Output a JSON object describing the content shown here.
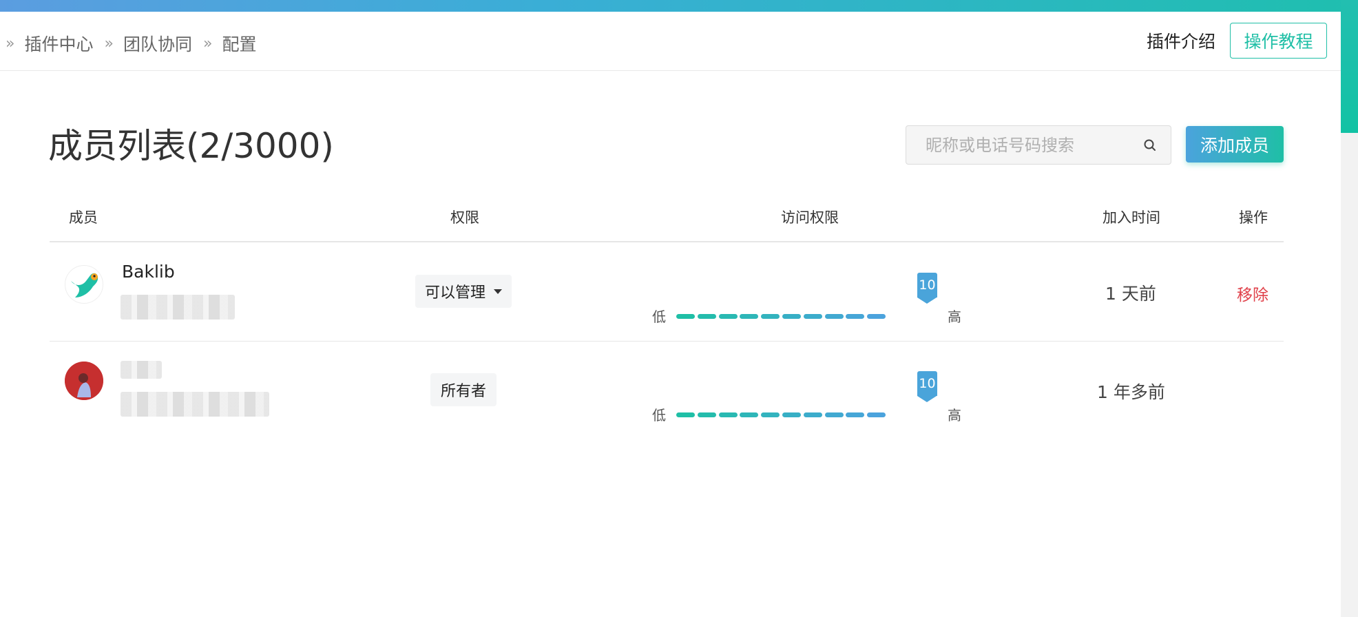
{
  "breadcrumb": {
    "items": [
      "插件中心",
      "团队协同",
      "配置"
    ],
    "separator": "»"
  },
  "header": {
    "intro_link": "插件介绍",
    "tutorial_button": "操作教程"
  },
  "page": {
    "title": "成员列表(2/3000)"
  },
  "search": {
    "placeholder": "昵称或电话号码搜索",
    "value": ""
  },
  "toolbar": {
    "add_member_button": "添加成员"
  },
  "table": {
    "columns": [
      "成员",
      "权限",
      "访问权限",
      "加入时间",
      "操作"
    ],
    "rows": [
      {
        "name": "Baklib",
        "permission": "可以管理",
        "permission_type": "dropdown",
        "access_level": 10,
        "access_low_label": "低",
        "access_high_label": "高",
        "joined": "1 天前",
        "action": "移除",
        "avatar_icon": "parrot-logo-icon"
      },
      {
        "name": "",
        "permission": "所有者",
        "permission_type": "static",
        "access_level": 10,
        "access_low_label": "低",
        "access_high_label": "高",
        "joined": "1 年多前",
        "action": "",
        "avatar_icon": "user-photo-avatar"
      }
    ]
  },
  "colors": {
    "accent_teal": "#1fbfa6",
    "accent_blue": "#4ba3dd",
    "danger": "#e0424b"
  }
}
